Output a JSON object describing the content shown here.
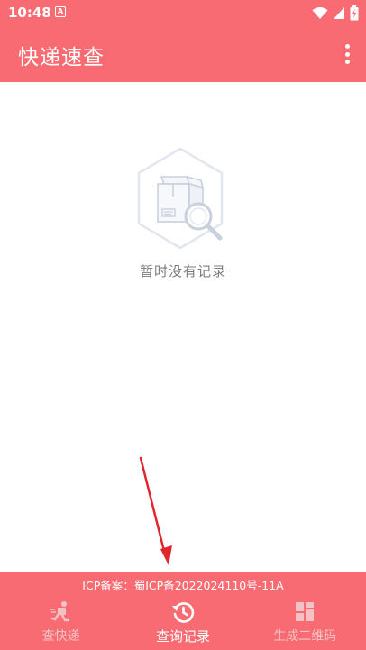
{
  "status_bar": {
    "time": "10:48",
    "notification_icon": "a-icon",
    "icons": [
      "wifi-icon",
      "signal-icon",
      "battery-icon"
    ]
  },
  "app_bar": {
    "title": "快递速查",
    "menu_icon": "more-vert-icon"
  },
  "empty_state": {
    "icon": "package-search-icon",
    "message": "暂时没有记录"
  },
  "footer": {
    "icp_text": "ICP备案：蜀ICP备2022024110号-11A"
  },
  "bottom_nav": {
    "selected": "查询记录",
    "items": [
      {
        "label": "查快递",
        "icon": "courier-run-icon"
      },
      {
        "label": "查询记录",
        "icon": "history-icon"
      },
      {
        "label": "生成二维码",
        "icon": "qr-grid-icon"
      }
    ]
  },
  "colors": {
    "primary": "#f86b72",
    "inactive_nav": "#f4c2c4",
    "empty_text": "#7a7a7a",
    "annotation_arrow": "#e0252b"
  }
}
